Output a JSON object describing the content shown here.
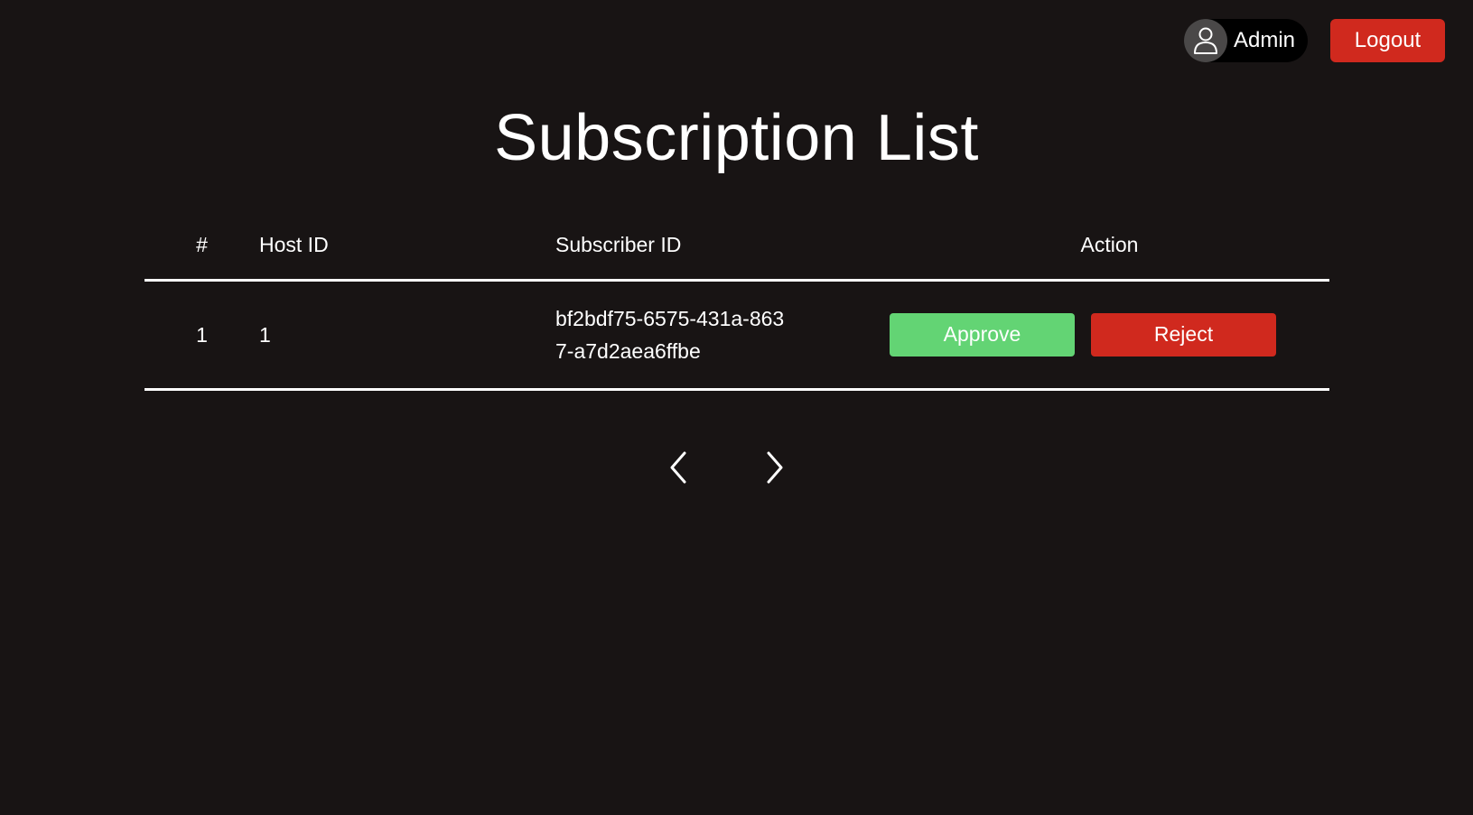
{
  "header": {
    "user_name": "Admin",
    "logout_label": "Logout",
    "avatar_icon": "user-icon"
  },
  "page": {
    "title": "Subscription List"
  },
  "table": {
    "columns": [
      "#",
      "Host ID",
      "Subscriber ID",
      "Action"
    ],
    "rows": [
      {
        "index": "1",
        "host_id": "1",
        "subscriber_id": "bf2bdf75-6575-431a-8637-a7d2aea6ffbe",
        "approve_label": "Approve",
        "reject_label": "Reject"
      }
    ]
  },
  "pagination": {
    "prev_icon": "chevron-left-icon",
    "next_icon": "chevron-right-icon"
  },
  "colors": {
    "background": "#181414",
    "approve": "#63d474",
    "reject": "#d0291e",
    "logout": "#d0291e"
  }
}
